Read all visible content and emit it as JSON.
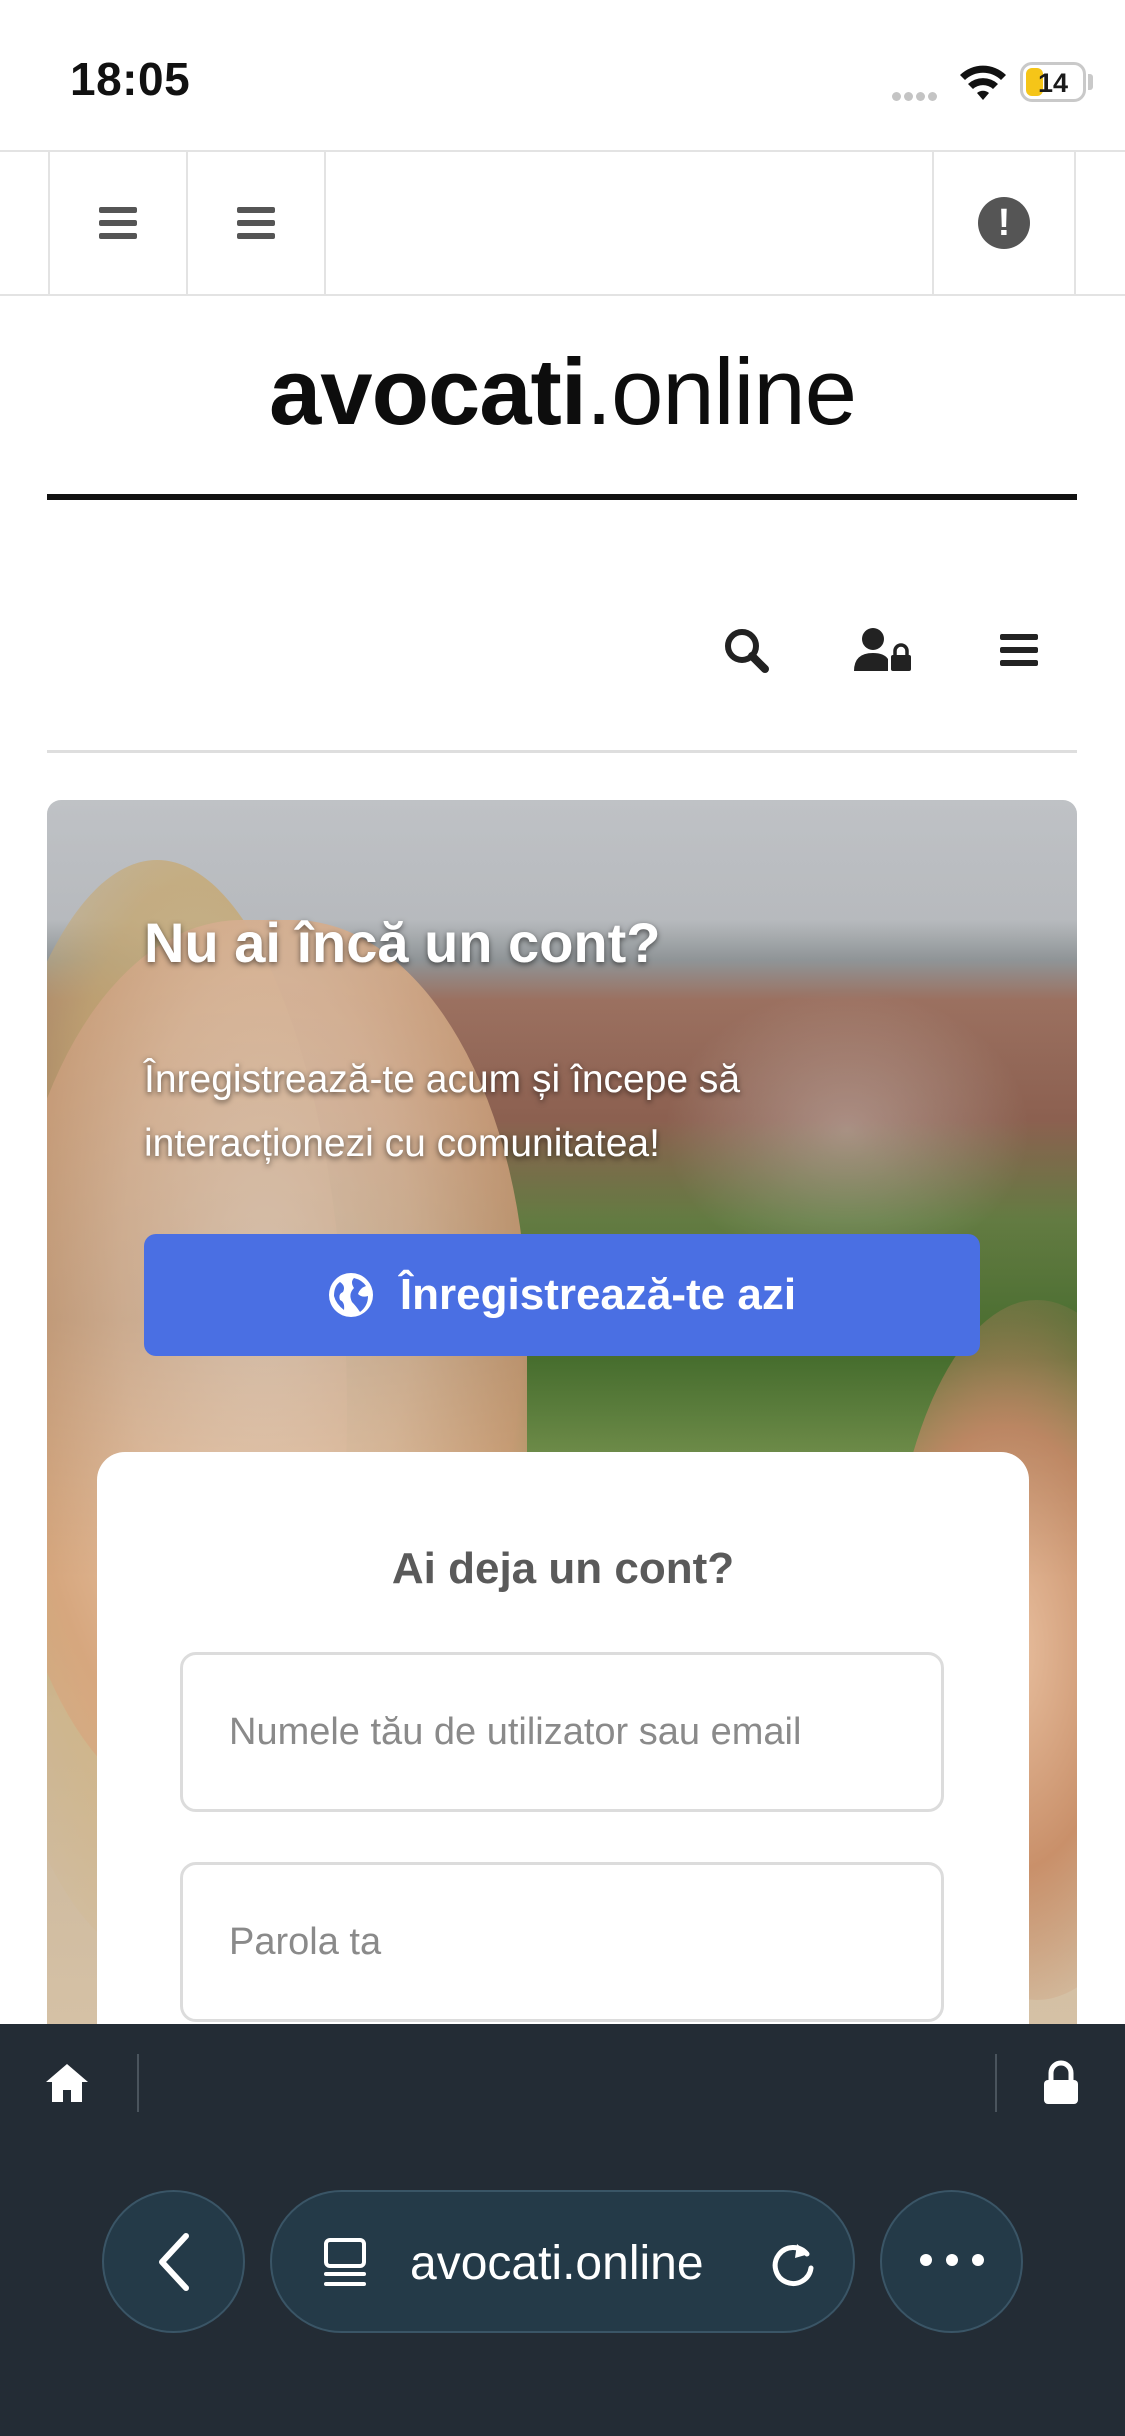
{
  "status_bar": {
    "time": "18:05",
    "battery": "14",
    "battery_color": "#f5c518"
  },
  "top_nav": {
    "menu_icon_1": "hamburger-icon",
    "menu_icon_2": "hamburger-icon",
    "alert_icon": "exclamation-circle-icon",
    "alert_glyph": "!"
  },
  "logo": {
    "bold": "avocati",
    "light": ".online"
  },
  "secondary_nav": {
    "icons": [
      "search-icon",
      "user-lock-icon",
      "hamburger-icon"
    ]
  },
  "hero": {
    "title": "Nu ai încă un cont?",
    "subtitle": "Înregistrează-te acum și începe să interacționezi cu comunitatea!",
    "register_button": "Înregistrează-te azi",
    "button_color": "#4a6fe3"
  },
  "login": {
    "title": "Ai deja un cont?",
    "username_placeholder": "Numele tău de utilizator sau email",
    "password_placeholder": "Parola ta"
  },
  "browser": {
    "url": "avocati.online",
    "chrome_color": "#232c35"
  }
}
